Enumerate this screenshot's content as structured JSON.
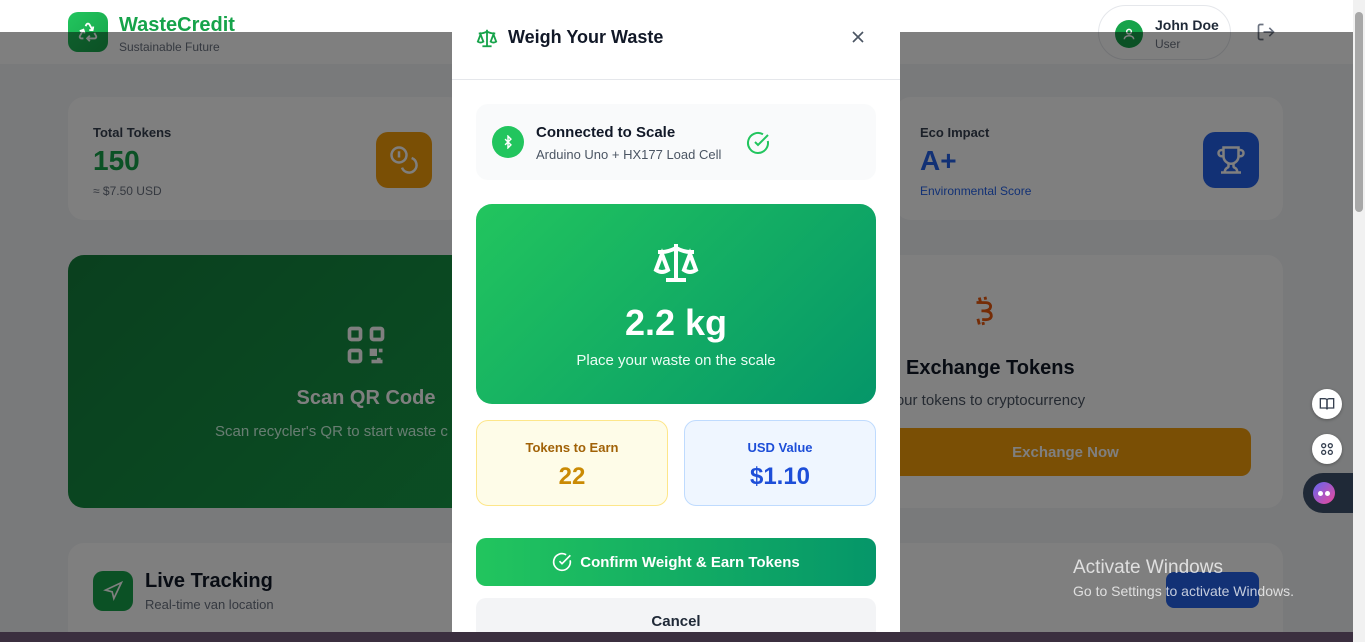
{
  "header": {
    "brand": "WasteCredit",
    "tagline": "Sustainable Future",
    "user_name": "John Doe",
    "user_role": "User"
  },
  "stats": {
    "total_tokens_label": "Total Tokens",
    "total_tokens_value": "150",
    "total_tokens_sub": "≈ $7.50 USD",
    "eco_label": "Eco Impact",
    "eco_value": "A+",
    "eco_sub": "Environmental Score"
  },
  "scan": {
    "title": "Scan QR Code",
    "subtitle": "Scan recycler's QR to start waste c"
  },
  "exchange": {
    "title": "Exchange Tokens",
    "subtitle": "t your tokens to cryptocurrency",
    "button": "Exchange Now"
  },
  "tracking": {
    "title": "Live Tracking",
    "subtitle": "Real-time van location"
  },
  "modal": {
    "title": "Weigh Your Waste",
    "connection_title": "Connected to Scale",
    "connection_sub": "Arduino Uno + HX177 Load Cell",
    "weight": "2.2 kg",
    "weight_hint": "Place your waste on the scale",
    "tokens_label": "Tokens to Earn",
    "tokens_value": "22",
    "usd_label": "USD Value",
    "usd_value": "$1.10",
    "confirm_button": "Confirm Weight & Earn Tokens",
    "cancel_button": "Cancel"
  },
  "watermark": {
    "title": "Activate Windows",
    "subtitle": "Go to Settings to activate Windows."
  },
  "colors": {
    "brand_green": "#16a34a",
    "accent_amber": "#f59e0b",
    "accent_blue": "#2563eb"
  }
}
